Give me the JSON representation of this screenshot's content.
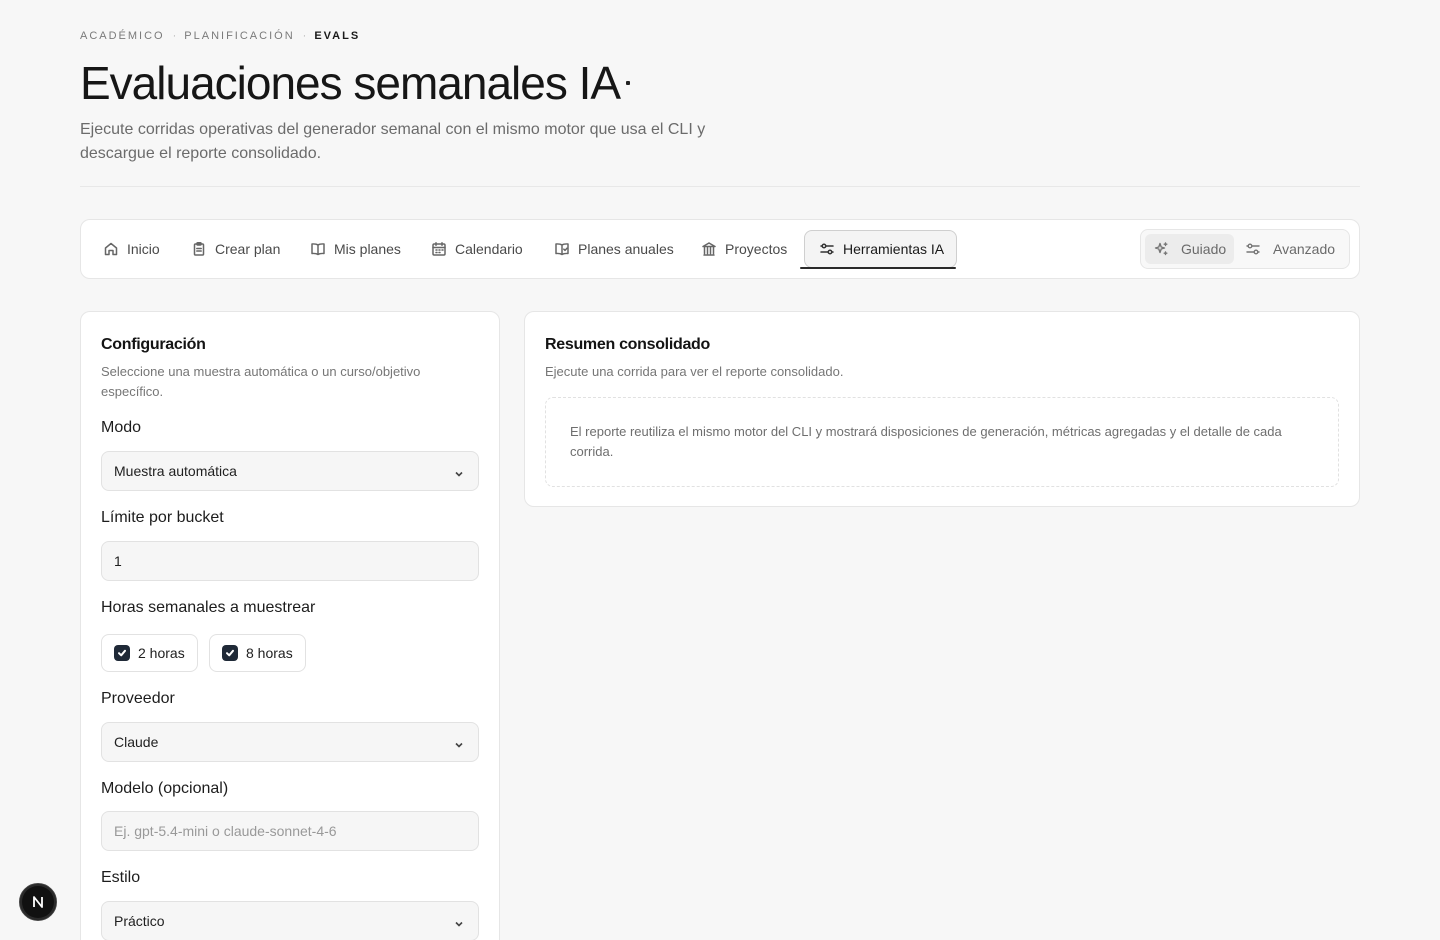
{
  "breadcrumb": [
    "ACADÉMICO",
    "PLANIFICACIÓN",
    "EVALS"
  ],
  "header": {
    "title": "Evaluaciones semanales IA",
    "description": "Ejecute corridas operativas del generador semanal con el mismo motor que usa el CLI y descargue el reporte consolidado."
  },
  "nav": {
    "tabs": [
      {
        "label": "Inicio",
        "icon": "home-icon"
      },
      {
        "label": "Crear plan",
        "icon": "clipboard-icon"
      },
      {
        "label": "Mis planes",
        "icon": "book-open-icon"
      },
      {
        "label": "Calendario",
        "icon": "calendar-icon"
      },
      {
        "label": "Planes anuales",
        "icon": "book-check-icon"
      },
      {
        "label": "Proyectos",
        "icon": "landmark-icon"
      },
      {
        "label": "Herramientas IA",
        "icon": "sliders-icon",
        "active": true
      }
    ],
    "mode": {
      "guided": "Guiado",
      "advanced": "Avanzado",
      "selected": "Guiado"
    }
  },
  "config": {
    "title": "Configuración",
    "subtitle": "Seleccione una muestra automática o un curso/objetivo específico.",
    "mode_label": "Modo",
    "mode_value": "Muestra automática",
    "limit_label": "Límite por bucket",
    "limit_value": "1",
    "hours_label": "Horas semanales a muestrear",
    "hours": [
      {
        "label": "2 horas",
        "checked": true
      },
      {
        "label": "8 horas",
        "checked": true
      }
    ],
    "provider_label": "Proveedor",
    "provider_value": "Claude",
    "model_label": "Modelo (opcional)",
    "model_placeholder": "Ej. gpt-5.4-mini o claude-sonnet-4-6",
    "style_label": "Estilo",
    "style_value": "Práctico"
  },
  "summary": {
    "title": "Resumen consolidado",
    "subtitle": "Ejecute una corrida para ver el reporte consolidado.",
    "empty_text": "El reporte reutiliza el mismo motor del CLI y mostrará disposiciones de generación, métricas agregadas y el detalle de cada corrida."
  },
  "badge": {
    "letter": "N"
  }
}
